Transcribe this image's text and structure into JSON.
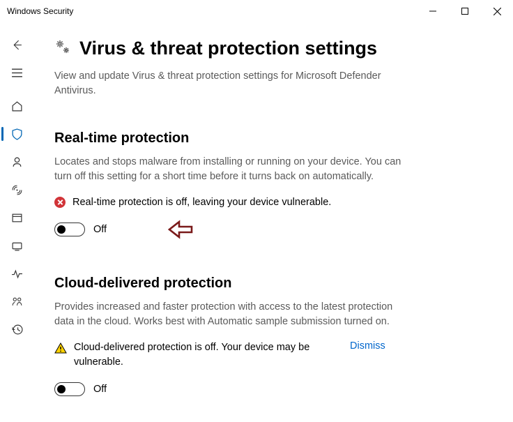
{
  "window": {
    "title": "Windows Security"
  },
  "page": {
    "title": "Virus & threat protection settings",
    "description": "View and update Virus & threat protection settings for Microsoft Defender Antivirus."
  },
  "sections": {
    "realtime": {
      "heading": "Real-time protection",
      "description": "Locates and stops malware from installing or running on your device. You can turn off this setting for a short time before it turns back on automatically.",
      "alert": "Real-time protection is off, leaving your device vulnerable.",
      "toggle_label": "Off"
    },
    "cloud": {
      "heading": "Cloud-delivered protection",
      "description": "Provides increased and faster protection with access to the latest protection data in the cloud. Works best with Automatic sample submission turned on.",
      "alert": "Cloud-delivered protection is off. Your device may be vulnerable.",
      "dismiss": "Dismiss",
      "toggle_label": "Off"
    }
  }
}
